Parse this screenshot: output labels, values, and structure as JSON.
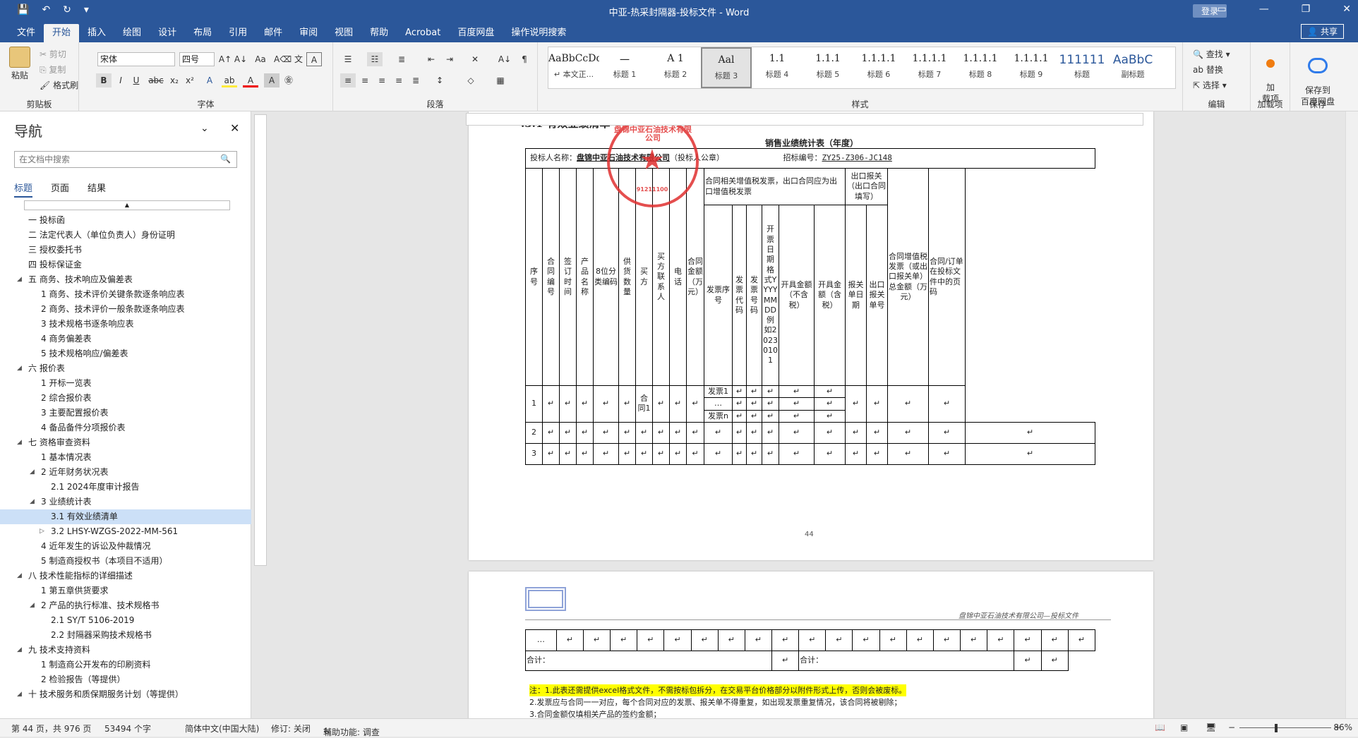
{
  "window": {
    "title": "中亚-热采封隔器-投标文件  -  Word",
    "login": "登录",
    "share": "共享"
  },
  "menu": {
    "tabs": [
      "文件",
      "开始",
      "插入",
      "绘图",
      "设计",
      "布局",
      "引用",
      "邮件",
      "审阅",
      "视图",
      "帮助",
      "Acrobat",
      "百度网盘",
      "操作说明搜索"
    ],
    "active": 1
  },
  "ribbon": {
    "clipboard": {
      "label": "剪贴板",
      "paste": "粘贴",
      "cut": "剪切",
      "copy": "复制",
      "format_painter": "格式刷"
    },
    "font": {
      "label": "字体",
      "name": "宋体",
      "size": "四号"
    },
    "paragraph": {
      "label": "段落"
    },
    "styles": {
      "label": "样式",
      "items": [
        {
          "preview": "AaBbCcDdI",
          "name": "↵ 本文正..."
        },
        {
          "preview": "一",
          "name": "标题 1"
        },
        {
          "preview": "A 1",
          "name": "标题 2"
        },
        {
          "preview": "Aal",
          "name": "标题 3"
        },
        {
          "preview": "1.1",
          "name": "标题 4"
        },
        {
          "preview": "1.1.1",
          "name": "标题 5"
        },
        {
          "preview": "1.1.1.1",
          "name": "标题 6"
        },
        {
          "preview": "1.1.1.1",
          "name": "标题 7"
        },
        {
          "preview": "1.1.1.1",
          "name": "标题 8"
        },
        {
          "preview": "1.1.1.1",
          "name": "标题 9"
        },
        {
          "preview": "111111",
          "name": "标题"
        },
        {
          "preview": "AaBbC",
          "name": "副标题"
        }
      ],
      "selected": 3
    },
    "editing": {
      "label": "编辑",
      "find": "查找",
      "replace": "替换",
      "select": "选择"
    },
    "addins": {
      "label": "加载项",
      "btn": "加\n载项"
    },
    "save": {
      "label": "保存",
      "btn": "保存到\n百度网盘"
    }
  },
  "nav": {
    "title": "导航",
    "search_placeholder": "在文档中搜索",
    "tabs": [
      "标题",
      "页面",
      "结果"
    ],
    "items": [
      {
        "t": "一 投标函",
        "l": 0,
        "c": ""
      },
      {
        "t": "二 法定代表人（单位负责人）身份证明",
        "l": 0,
        "c": ""
      },
      {
        "t": "三 授权委托书",
        "l": 0,
        "c": ""
      },
      {
        "t": "四 投标保证金",
        "l": 0,
        "c": ""
      },
      {
        "t": "五 商务、技术响应及偏差表",
        "l": 0,
        "c": "◢"
      },
      {
        "t": "1 商务、技术评价关键条款逐条响应表",
        "l": 1,
        "c": ""
      },
      {
        "t": "2 商务、技术评价一般条款逐条响应表",
        "l": 1,
        "c": ""
      },
      {
        "t": "3 技术规格书逐条响应表",
        "l": 1,
        "c": ""
      },
      {
        "t": "4 商务偏差表",
        "l": 1,
        "c": ""
      },
      {
        "t": "5 技术规格响应/偏差表",
        "l": 1,
        "c": ""
      },
      {
        "t": "六 报价表",
        "l": 0,
        "c": "◢"
      },
      {
        "t": "1 开标一览表",
        "l": 1,
        "c": ""
      },
      {
        "t": "2 综合报价表",
        "l": 1,
        "c": ""
      },
      {
        "t": "3 主要配置报价表",
        "l": 1,
        "c": ""
      },
      {
        "t": "4 备品备件分项报价表",
        "l": 1,
        "c": ""
      },
      {
        "t": "七 资格审查资料",
        "l": 0,
        "c": "◢"
      },
      {
        "t": "1 基本情况表",
        "l": 1,
        "c": ""
      },
      {
        "t": "2 近年财务状况表",
        "l": 1,
        "c": "◢"
      },
      {
        "t": "2.1 2024年度审计报告",
        "l": 2,
        "c": ""
      },
      {
        "t": "3 业绩统计表",
        "l": 1,
        "c": "◢"
      },
      {
        "t": "3.1 有效业绩清单",
        "l": 2,
        "c": "",
        "sel": true
      },
      {
        "t": "3.2 LHSY-WZGS-2022-MM-561",
        "l": 2,
        "c": "▷"
      },
      {
        "t": "4 近年发生的诉讼及仲裁情况",
        "l": 1,
        "c": ""
      },
      {
        "t": "5 制造商授权书（本项目不适用）",
        "l": 1,
        "c": ""
      },
      {
        "t": "八 技术性能指标的详细描述",
        "l": 0,
        "c": "◢"
      },
      {
        "t": "1 第五章供货要求",
        "l": 1,
        "c": ""
      },
      {
        "t": "2 产品的执行标准、技术规格书",
        "l": 1,
        "c": "◢"
      },
      {
        "t": "2.1 SY/T 5106-2019",
        "l": 2,
        "c": ""
      },
      {
        "t": "2.2 封隔器采购技术规格书",
        "l": 2,
        "c": ""
      },
      {
        "t": "九 技术支持资料",
        "l": 0,
        "c": "◢"
      },
      {
        "t": "1 制造商公开发布的印刷资料",
        "l": 1,
        "c": ""
      },
      {
        "t": "2 检验报告（等提供）",
        "l": 1,
        "c": ""
      },
      {
        "t": "十 技术服务和质保期服务计划（等提供）",
        "l": 0,
        "c": "◢"
      }
    ]
  },
  "doc": {
    "heading": ".3.1 有效业绩清单",
    "table_title": "销售业绩统计表（年度）",
    "bidder_label": "投标人名称：",
    "bidder_name": "盘锦中亚石油技术有限公司",
    "bidder_seal": "（投标人公章）",
    "bid_no_label": "招标编号：",
    "bid_no": "ZY25-Z306-JC148",
    "headers": [
      "序号",
      "合同编号",
      "签订时间",
      "产品名称",
      "8位分类编码",
      "供货数量",
      "买方",
      "买方联系人",
      "电话",
      "合同金额（万元）"
    ],
    "invoice_group": "合同相关增值税发票，出口合同应为出口增值税发票",
    "invoice_headers": [
      "发票序号",
      "发票代码",
      "发票号码",
      "开票日期格式YYYYMMDD例如20230101",
      "开具金额（不含税）",
      "开具金额（含税）"
    ],
    "export_group": "出口报关（出口合同填写）",
    "export_headers": [
      "报关单日期",
      "出口报关单号"
    ],
    "total_header": "合同增值税发票（或出口报关单）总金额（万元）",
    "page_header": "合同/订单在投标文件中的页码",
    "rows": [
      "1",
      "2",
      "3"
    ],
    "invoice_rows": [
      "发票1",
      "…",
      "发票n"
    ],
    "buyer_cell": "合同1",
    "page_num": "44",
    "page2_header": "盘锦中亚石油技术有限公司—投标文件",
    "ellipsis": "…",
    "sum_label": "合计：",
    "notes": [
      "注：1.此表还需提供excel格式文件，不需按标包拆分，在交易平台价格部分以附件形式上传，否则会被废标。",
      "2.发票应与合同一一对应，每个合同对应的发票、报关单不得重复，如出现发票重复情况，该合同将被剔除；",
      "3.合同金额仅填相关产品的签约金额；"
    ],
    "stamp_text": "盘锦中亚石油技术有限公司",
    "stamp_code": "91211100"
  },
  "status": {
    "page": "第 44 页，共 976 页",
    "words": "53494 个字",
    "lang": "简体中文(中国大陆)",
    "track": "修订: 关闭",
    "access": "辅助功能: 调查",
    "zoom": "86%"
  }
}
